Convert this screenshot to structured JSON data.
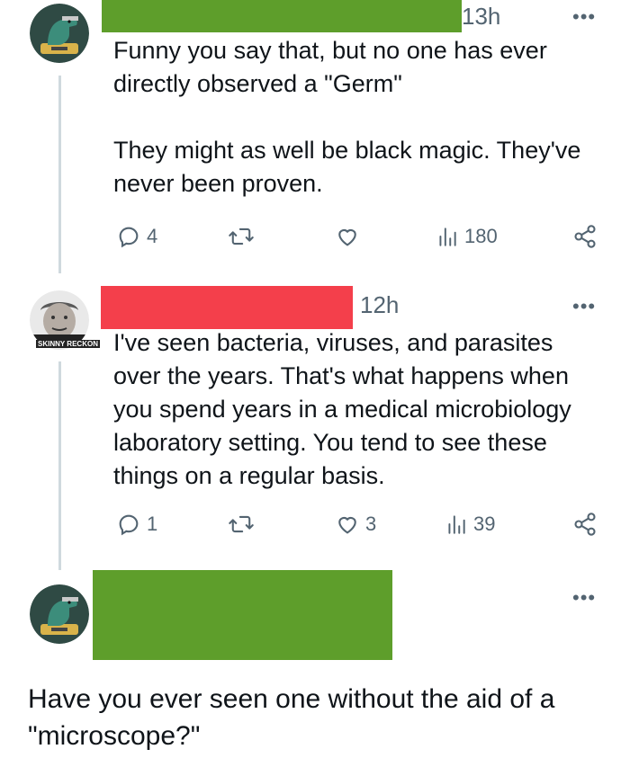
{
  "colors": {
    "redact_green": "#5e9e2b",
    "redact_red": "#f43f4b",
    "muted": "#536471",
    "thread_line": "#cfd9de"
  },
  "tweets": [
    {
      "time": "13h",
      "paragraphs": [
        "Funny you say that, but no one has ever directly observed a \"Germ\"",
        "They might as well be black magic. They've never been proven."
      ],
      "stats": {
        "replies": "4",
        "retweets": "",
        "likes": "",
        "views": "180"
      }
    },
    {
      "time": "12h",
      "avatar_caption": "SKINNY RECKON",
      "paragraphs": [
        "I've seen bacteria, viruses, and parasites over the years. That's what happens when you spend years in a medical microbiology laboratory setting. You tend to see these things on a regular basis."
      ],
      "stats": {
        "replies": "1",
        "retweets": "",
        "likes": "3",
        "views": "39"
      }
    },
    {
      "time": "",
      "paragraphs": []
    }
  ],
  "reply": {
    "text": "Have you ever seen one without the aid of a \"microscope?\""
  }
}
